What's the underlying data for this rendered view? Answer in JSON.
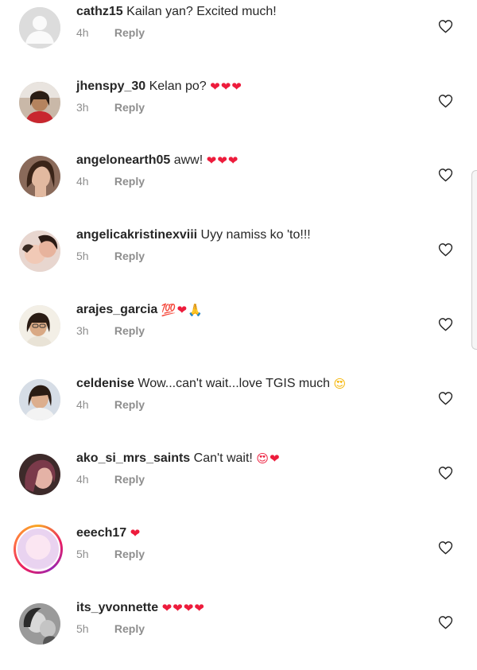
{
  "comments": [
    {
      "username": "cathz15",
      "text": "Kailan yan? Excited much!",
      "emoji": "",
      "time": "4h",
      "reply": "Reply",
      "avatar": "default-avatar"
    },
    {
      "username": "jhenspy_30",
      "text": "Kelan po?",
      "emoji": "❤❤❤",
      "time": "3h",
      "reply": "Reply",
      "avatar": "photo-avatar"
    },
    {
      "username": "angelonearth05",
      "text": "aww!",
      "emoji": "❤❤❤",
      "time": "4h",
      "reply": "Reply",
      "avatar": "photo-avatar"
    },
    {
      "username": "angelicakristinexviii",
      "text": "Uyy namiss ko 'to!!!",
      "emoji": "",
      "time": "5h",
      "reply": "Reply",
      "avatar": "photo-avatar"
    },
    {
      "username": "arajes_garcia",
      "text": "",
      "emoji": "💯❤🙏",
      "time": "3h",
      "reply": "Reply",
      "avatar": "photo-avatar"
    },
    {
      "username": "celdenise",
      "text": "Wow...can't wait...love TGIS much",
      "emoji": "😍",
      "time": "4h",
      "reply": "Reply",
      "avatar": "photo-avatar"
    },
    {
      "username": "ako_si_mrs_saints",
      "text": "Can't wait!",
      "emoji": "😍❤",
      "time": "4h",
      "reply": "Reply",
      "avatar": "photo-avatar"
    },
    {
      "username": "eeech17",
      "text": "",
      "emoji": "❤",
      "time": "5h",
      "reply": "Reply",
      "avatar": "story-avatar"
    },
    {
      "username": "its_yvonnette",
      "text": "",
      "emoji": "❤❤❤❤",
      "time": "5h",
      "reply": "Reply",
      "avatar": "photo-avatar"
    }
  ],
  "icons": {
    "like": "heart-outline-icon"
  },
  "colors": {
    "text": "#262626",
    "meta": "#8e8e8e",
    "heart": "#ed1c3c"
  }
}
